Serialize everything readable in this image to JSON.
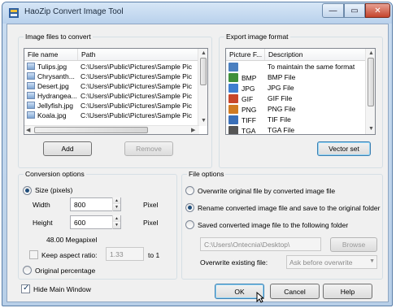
{
  "window": {
    "title": "HaoZip Convert Image Tool"
  },
  "caption_buttons": {
    "minimize": "—",
    "maximize": "▭",
    "close": "✕"
  },
  "files_group": {
    "label": "Image files to convert",
    "columns": [
      "File name",
      "Path"
    ],
    "rows": [
      {
        "name": "Tulips.jpg",
        "path": "C:\\Users\\Public\\Pictures\\Sample Pic"
      },
      {
        "name": "Chrysanth...",
        "path": "C:\\Users\\Public\\Pictures\\Sample Pic"
      },
      {
        "name": "Desert.jpg",
        "path": "C:\\Users\\Public\\Pictures\\Sample Pic"
      },
      {
        "name": "Hydrangea...",
        "path": "C:\\Users\\Public\\Pictures\\Sample Pic"
      },
      {
        "name": "Jellyfish.jpg",
        "path": "C:\\Users\\Public\\Pictures\\Sample Pic"
      },
      {
        "name": "Koala.jpg",
        "path": "C:\\Users\\Public\\Pictures\\Sample Pic"
      }
    ],
    "add_label": "Add",
    "remove_label": "Remove"
  },
  "export_group": {
    "label": "Export image format",
    "columns": [
      "Picture F...",
      "Description"
    ],
    "rows": [
      {
        "format": "",
        "description": "To maintain the same format",
        "icon": "file-icon",
        "color": "#4a7fc0"
      },
      {
        "format": "BMP",
        "description": "BMP File",
        "icon": "bmp-icon",
        "color": "#3f8f3a"
      },
      {
        "format": "JPG",
        "description": "JPG File",
        "icon": "jpg-icon",
        "color": "#3f7ed0"
      },
      {
        "format": "GIF",
        "description": "GIF File",
        "icon": "gif-icon",
        "color": "#c8462a"
      },
      {
        "format": "PNG",
        "description": "PNG File",
        "icon": "png-icon",
        "color": "#d07b22"
      },
      {
        "format": "TIFF",
        "description": "TIF File",
        "icon": "tiff-icon",
        "color": "#3a6fb8"
      },
      {
        "format": "TGA",
        "description": "TGA File",
        "icon": "tga-icon",
        "color": "#555555"
      }
    ],
    "vector_set_label": "Vector set"
  },
  "conversion_group": {
    "label": "Conversion options",
    "size_option": "Size (pixels)",
    "width_label": "Width",
    "width_value": "800",
    "width_unit": "Pixel",
    "height_label": "Height",
    "height_value": "600",
    "height_unit": "Pixel",
    "megapixel": "48.00 Megapixel",
    "keep_aspect_label": "Keep aspect ratio:",
    "aspect_value": "1.33",
    "aspect_suffix": "to 1",
    "original_percentage": "Original percentage"
  },
  "file_options_group": {
    "label": "File options",
    "overwrite_option": "Overwrite original file by converted image file",
    "rename_option": "Rename converted image file and save to the original folder",
    "saved_option": "Saved converted image file to the following folder",
    "folder_path": "C:\\Users\\Ontecnia\\Desktop\\",
    "browse_label": "Browse",
    "overwrite_existing_label": "Overwrite existing file:",
    "overwrite_existing_value": "Ask before overwrite"
  },
  "footer": {
    "hide_main_window": "Hide Main Window",
    "ok_label": "OK",
    "cancel_label": "Cancel",
    "help_label": "Help"
  }
}
